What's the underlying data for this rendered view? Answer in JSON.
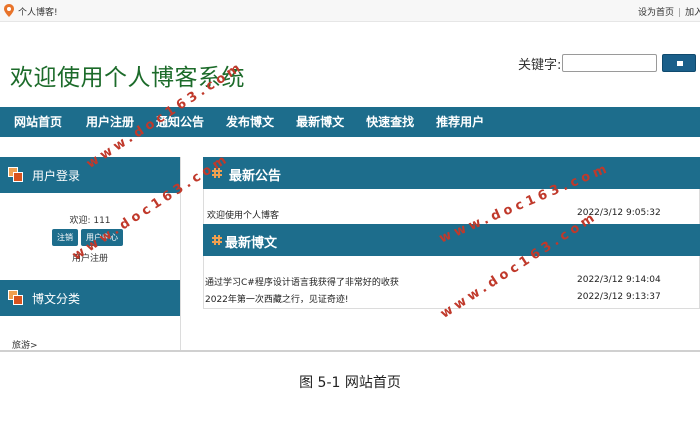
{
  "topbar": {
    "welcome": "个人博客!",
    "links": [
      "设为首页",
      "加入收"
    ]
  },
  "header": {
    "site_title": "欢迎使用个人博客系统",
    "search_label": "关键字:",
    "search_value": ""
  },
  "nav": {
    "items": [
      "网站首页",
      "用户注册",
      "通知公告",
      "发布博文",
      "最新博文",
      "快速查找",
      "推荐用户"
    ]
  },
  "sidebar": {
    "login_title": "用户登录",
    "hello": "欢迎: 111",
    "logout": "注销",
    "user_center": "用户中心",
    "register": "用户注册",
    "category_title": "博文分类",
    "categories": [
      "旅游>"
    ]
  },
  "notices": {
    "title": "最新公告",
    "items": [
      {
        "text": "欢迎使用个人博客",
        "date": "2022/3/12 9:05:32"
      }
    ]
  },
  "posts": {
    "title": "最新博文",
    "items": [
      {
        "text": "通过学习C#程序设计语言我获得了非常好的收获",
        "date": "2022/3/12 9:14:04"
      },
      {
        "text": "2022年第一次西藏之行，见证奇迹!",
        "date": "2022/3/12 9:13:37"
      }
    ]
  },
  "watermarks": [
    "www.doc163.com",
    "www.doc163.com",
    "www.doc163.com",
    "www.doc163.com"
  ],
  "caption": "图 5-1 网站首页",
  "colors": {
    "nav_bg": "#1d6d8c",
    "title_green": "#1c6b2a",
    "watermark": "#c0392b"
  }
}
